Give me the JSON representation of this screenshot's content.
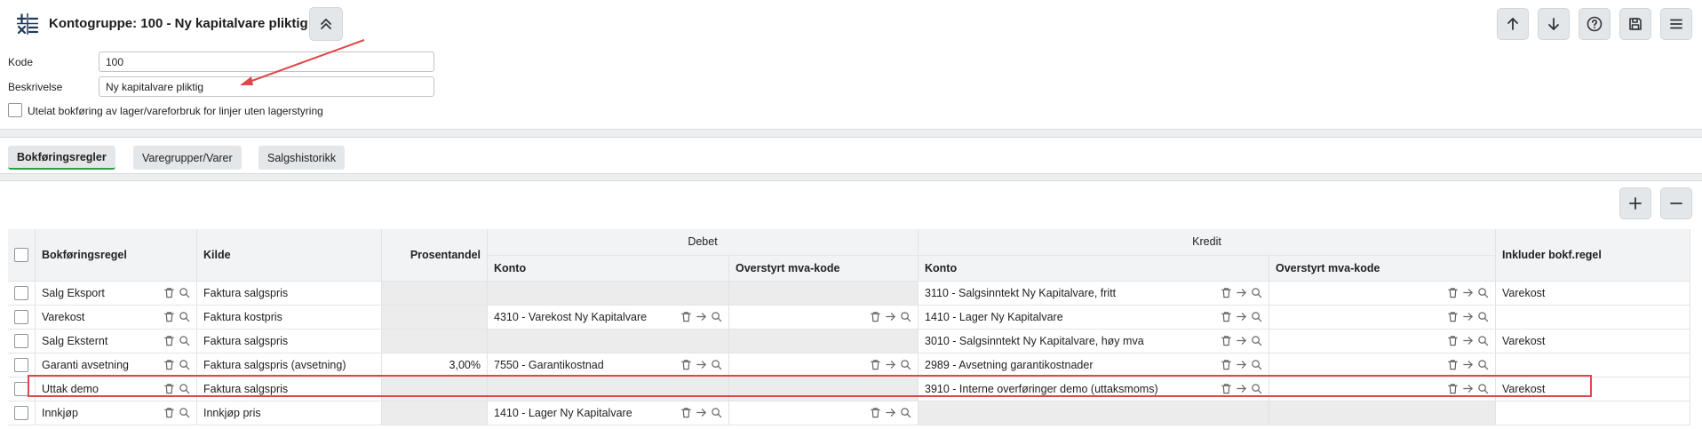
{
  "header": {
    "title": "Kontogruppe: 100 - Ny kapitalvare pliktig",
    "icon": "calculator-icon"
  },
  "toolbar": {
    "buttons": [
      "arrow-up-icon",
      "arrow-down-icon",
      "help-icon",
      "save-icon",
      "menu-icon"
    ]
  },
  "form": {
    "kode_label": "Kode",
    "kode_value": "100",
    "beskrivelse_label": "Beskrivelse",
    "beskrivelse_value": "Ny kapitalvare pliktig",
    "checkbox_label": "Utelat bokføring av lager/vareforbruk for linjer uten lagerstyring",
    "checkbox_checked": false
  },
  "tabs": [
    {
      "label": "Bokføringsregler",
      "active": true
    },
    {
      "label": "Varegrupper/Varer",
      "active": false
    },
    {
      "label": "Salgshistorikk",
      "active": false
    }
  ],
  "table": {
    "group_debet": "Debet",
    "group_kredit": "Kredit",
    "col_bokforingsregel": "Bokføringsregel",
    "col_kilde": "Kilde",
    "col_prosentandel": "Prosentandel",
    "col_debet_konto": "Konto",
    "col_debet_mva": "Overstyrt mva-kode",
    "col_kredit_konto": "Konto",
    "col_kredit_mva": "Overstyrt mva-kode",
    "col_inkluder": "Inkluder bokf.regel",
    "rows": [
      {
        "regel": "Salg Eksport",
        "kilde": "Faktura salgspris",
        "prosent": "",
        "debet_konto": "",
        "debet_mva": "",
        "kredit_konto": "3110 - Salgsinntekt Ny Kapitalvare, fritt",
        "kredit_mva": "",
        "inkluder": "Varekost"
      },
      {
        "regel": "Varekost",
        "kilde": "Faktura kostpris",
        "prosent": "",
        "debet_konto": "4310 - Varekost Ny Kapitalvare",
        "debet_mva": "",
        "kredit_konto": "1410 - Lager Ny Kapitalvare",
        "kredit_mva": "",
        "inkluder": ""
      },
      {
        "regel": "Salg Eksternt",
        "kilde": "Faktura salgspris",
        "prosent": "",
        "debet_konto": "",
        "debet_mva": "",
        "kredit_konto": "3010 - Salgsinntekt Ny Kapitalvare, høy mva",
        "kredit_mva": "",
        "inkluder": "Varekost"
      },
      {
        "regel": "Garanti avsetning",
        "kilde": "Faktura salgspris (avsetning)",
        "prosent": "3,00%",
        "debet_konto": "7550 - Garantikostnad",
        "debet_mva": "",
        "kredit_konto": "2989 - Avsetning garantikostnader",
        "kredit_mva": "",
        "inkluder": ""
      },
      {
        "regel": "Uttak demo",
        "kilde": "Faktura salgspris",
        "prosent": "",
        "debet_konto": "",
        "debet_mva": "",
        "kredit_konto": "3910 - Interne overføringer demo (uttaksmoms)",
        "kredit_mva": "",
        "inkluder": "Varekost"
      },
      {
        "regel": "Innkjøp",
        "kilde": "Innkjøp pris",
        "prosent": "",
        "debet_konto": "1410 - Lager Ny Kapitalvare",
        "debet_mva": "",
        "kredit_konto": "",
        "kredit_mva": "",
        "inkluder": ""
      }
    ]
  },
  "colors": {
    "accent_green": "#2ea043",
    "highlight_red": "#e04848"
  }
}
